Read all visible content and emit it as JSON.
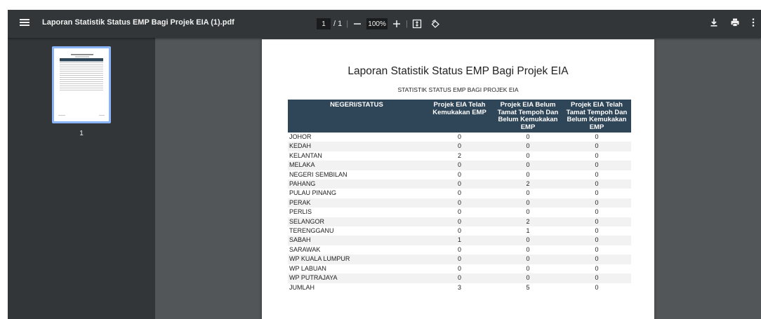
{
  "toolbar": {
    "title": "Laporan Statistik Status EMP Bagi Projek EIA (1).pdf",
    "page_current": "1",
    "page_total": "/ 1",
    "zoom": "100%"
  },
  "sidebar": {
    "thumbnail_page_number": "1"
  },
  "document": {
    "title": "Laporan Statistik Status EMP Bagi Projek EIA",
    "subtitle": "STATISTIK STATUS EMP BAGI PROJEK EIA",
    "table": {
      "headers": [
        "NEGERI/STATUS",
        "Projek EIA Telah Kemukakan EMP",
        "Projek EIA Belum Tamat Tempoh Dan Belum Kemukakan EMP",
        "Projek EIA Telah Tamat Tempoh Dan Belum Kemukakan EMP"
      ],
      "rows": [
        [
          "JOHOR",
          "0",
          "0",
          "0"
        ],
        [
          "KEDAH",
          "0",
          "0",
          "0"
        ],
        [
          "KELANTAN",
          "2",
          "0",
          "0"
        ],
        [
          "MELAKA",
          "0",
          "0",
          "0"
        ],
        [
          "NEGERI SEMBILAN",
          "0",
          "0",
          "0"
        ],
        [
          "PAHANG",
          "0",
          "2",
          "0"
        ],
        [
          "PULAU PINANG",
          "0",
          "0",
          "0"
        ],
        [
          "PERAK",
          "0",
          "0",
          "0"
        ],
        [
          "PERLIS",
          "0",
          "0",
          "0"
        ],
        [
          "SELANGOR",
          "0",
          "2",
          "0"
        ],
        [
          "TERENGGANU",
          "0",
          "1",
          "0"
        ],
        [
          "SABAH",
          "1",
          "0",
          "0"
        ],
        [
          "SARAWAK",
          "0",
          "0",
          "0"
        ],
        [
          "WP KUALA LUMPUR",
          "0",
          "0",
          "0"
        ],
        [
          "WP LABUAN",
          "0",
          "0",
          "0"
        ],
        [
          "WP PUTRAJAYA",
          "0",
          "0",
          "0"
        ],
        [
          "JUMLAH",
          "3",
          "5",
          "0"
        ]
      ]
    }
  },
  "icons": {
    "menu": "menu-icon",
    "zoom_out": "minus-icon",
    "zoom_in": "plus-icon",
    "fit": "fit-to-page-icon",
    "rotate": "rotate-icon",
    "download": "download-icon",
    "print": "print-icon",
    "more": "more-vert-icon"
  },
  "colors": {
    "toolbar": "#323639",
    "viewer_bg": "#525659",
    "table_header": "#2f4558",
    "thumb_highlight": "#8ab4f8"
  }
}
